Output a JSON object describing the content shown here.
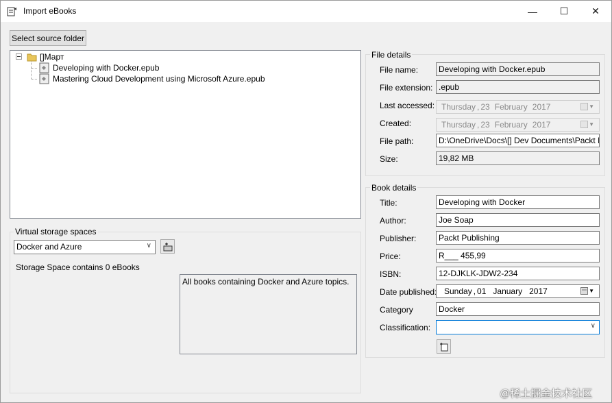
{
  "window": {
    "title": "Import eBooks",
    "minimize": "—",
    "maximize": "☐",
    "close": "✕"
  },
  "toolbar": {
    "select_source": "Select source folder"
  },
  "tree": {
    "root": "[]Март",
    "items": [
      "Developing with Docker.epub",
      "Mastering Cloud Development using Microsoft Azure.epub"
    ]
  },
  "virtual": {
    "group": "Virtual storage spaces",
    "selected": "Docker and Azure",
    "status": "Storage Space contains 0 eBooks",
    "description": "All books containing Docker and Azure topics."
  },
  "file": {
    "group": "File details",
    "name_label": "File name:",
    "name": "Developing with Docker.epub",
    "ext_label": "File extension:",
    "ext": ".epub",
    "accessed_label": "Last accessed:",
    "accessed": {
      "day": "Thursday",
      "d": "23",
      "month": "February",
      "year": "2017"
    },
    "created_label": "Created:",
    "created": {
      "day": "Thursday",
      "d": "23",
      "month": "February",
      "year": "2017"
    },
    "path_label": "File path:",
    "path": "D:\\OneDrive\\Docs\\[] Dev Documents\\Packt Pub",
    "size_label": "Size:",
    "size": "19,82 MB"
  },
  "book": {
    "group": "Book details",
    "title_label": "Title:",
    "title": "Developing with Docker",
    "author_label": "Author:",
    "author": "Joe Soap",
    "publisher_label": "Publisher:",
    "publisher": "Packt Publishing",
    "price_label": "Price:",
    "price": "R___ 455,99",
    "isbn_label": "ISBN:",
    "isbn": "12-DJKLK-JDW2-234",
    "date_label": "Date published:",
    "published": {
      "day": "Sunday",
      "d": "01",
      "month": "January",
      "year": "2017"
    },
    "category_label": "Category",
    "category": "Docker",
    "class_label": "Classification:",
    "classification": ""
  },
  "watermark": "@稀土掘金技术社区"
}
